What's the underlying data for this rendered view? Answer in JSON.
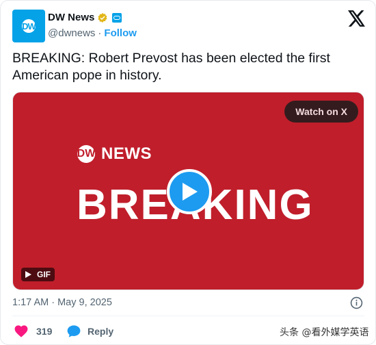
{
  "author": {
    "avatar_text": "DW",
    "name": "DW News",
    "handle": "@dwnews",
    "separator": "·",
    "follow_label": "Follow"
  },
  "tweet": {
    "text": "BREAKING: Robert Prevost has been elected the first American pope in history."
  },
  "media": {
    "watch_label": "Watch on X",
    "brand_circle": "DW",
    "brand_text": "NEWS",
    "headline": "BREAKING",
    "gif_label": "GIF",
    "background_color": "#c01e2b"
  },
  "timestamp": "1:17 AM · May 9, 2025",
  "actions": {
    "like_count": "319",
    "reply_label": "Reply"
  },
  "watermark": "头条 @看外媒学英语",
  "colors": {
    "accent": "#1d9bf0",
    "like": "#f91880",
    "brand_blue": "#05a2e8"
  }
}
